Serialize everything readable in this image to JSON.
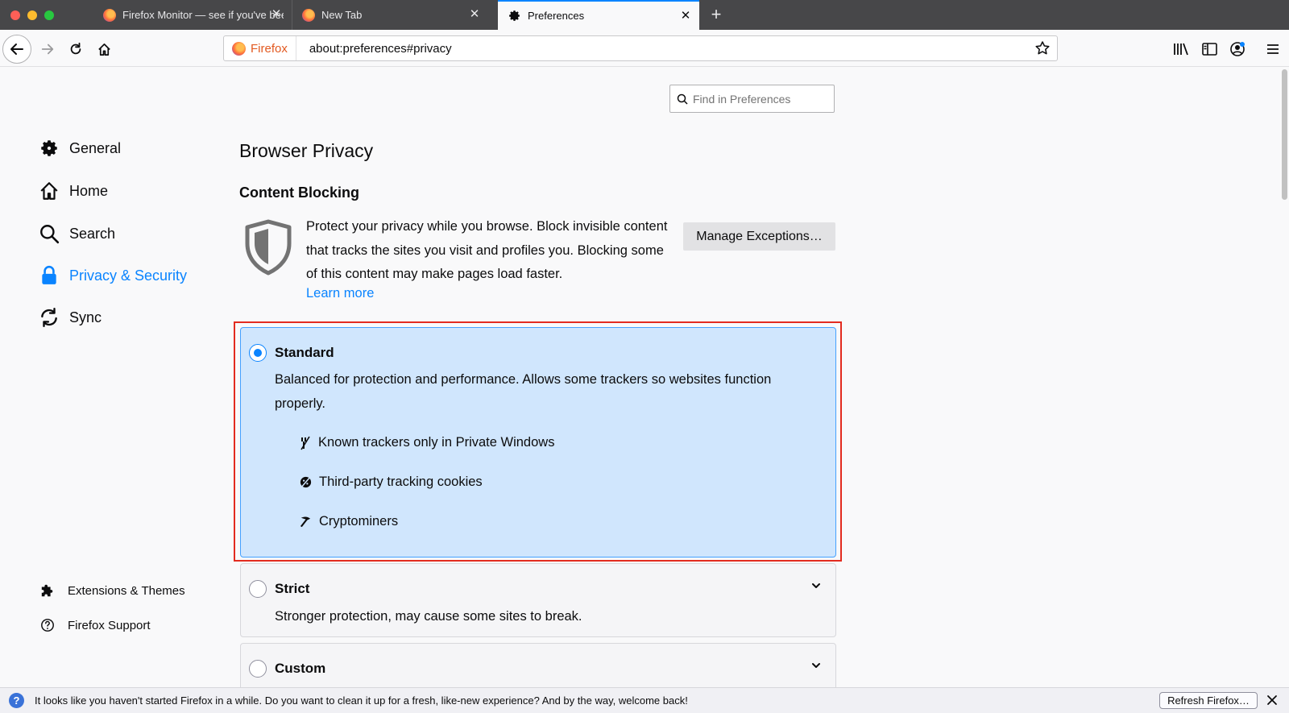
{
  "tabs": [
    {
      "title": "Firefox Monitor — see if you've been part of an online data breach"
    },
    {
      "title": "New Tab"
    },
    {
      "title": "Preferences"
    }
  ],
  "urlbar": {
    "identity_label": "Firefox",
    "url": "about:preferences#privacy"
  },
  "search": {
    "placeholder": "Find in Preferences"
  },
  "sidebar": {
    "items": [
      {
        "label": "General",
        "icon": "gear-icon"
      },
      {
        "label": "Home",
        "icon": "home-icon"
      },
      {
        "label": "Search",
        "icon": "search-icon"
      },
      {
        "label": "Privacy & Security",
        "icon": "lock-icon",
        "selected": true
      },
      {
        "label": "Sync",
        "icon": "sync-icon"
      }
    ],
    "footer": [
      {
        "label": "Extensions & Themes",
        "icon": "puzzle-icon"
      },
      {
        "label": "Firefox Support",
        "icon": "help-icon"
      }
    ]
  },
  "main": {
    "page_title": "Browser Privacy",
    "section_title": "Content Blocking",
    "description": "Protect your privacy while you browse. Block invisible content that tracks the sites you visit and profiles you. Blocking some of this content may make pages load faster.",
    "learn_more": "Learn more",
    "manage_exceptions": "Manage Exceptions…",
    "options": [
      {
        "label": "Standard",
        "selected": true,
        "description": "Balanced for protection and performance. Allows some trackers so websites function properly.",
        "items": [
          "Known trackers only in Private Windows",
          "Third-party tracking cookies",
          "Cryptominers"
        ]
      },
      {
        "label": "Strict",
        "selected": false,
        "description": "Stronger protection, may cause some sites to break."
      },
      {
        "label": "Custom",
        "selected": false
      }
    ]
  },
  "notification": {
    "text": "It looks like you haven't started Firefox in a while. Do you want to clean it up for a fresh, like-new experience? And by the way, welcome back!",
    "button": "Refresh Firefox…"
  },
  "colors": {
    "accent": "#0a84ff",
    "highlight_border": "#e22b1f",
    "selected_option": "#d0e6fd"
  }
}
